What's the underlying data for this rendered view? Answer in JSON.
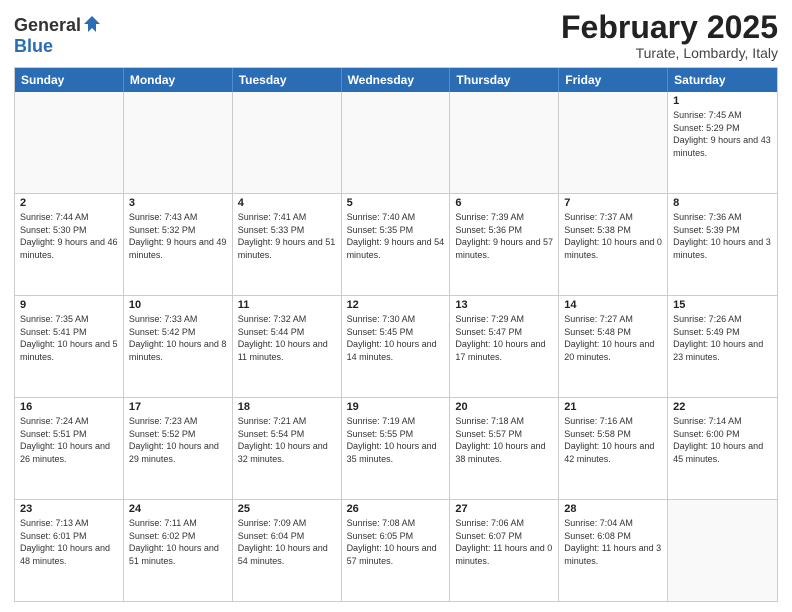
{
  "logo": {
    "general": "General",
    "blue": "Blue"
  },
  "title": "February 2025",
  "location": "Turate, Lombardy, Italy",
  "header": {
    "days": [
      "Sunday",
      "Monday",
      "Tuesday",
      "Wednesday",
      "Thursday",
      "Friday",
      "Saturday"
    ]
  },
  "weeks": [
    {
      "cells": [
        {
          "day": "",
          "empty": true
        },
        {
          "day": "",
          "empty": true
        },
        {
          "day": "",
          "empty": true
        },
        {
          "day": "",
          "empty": true
        },
        {
          "day": "",
          "empty": true
        },
        {
          "day": "",
          "empty": true
        },
        {
          "day": "1",
          "info": "Sunrise: 7:45 AM\nSunset: 5:29 PM\nDaylight: 9 hours and 43 minutes."
        }
      ]
    },
    {
      "cells": [
        {
          "day": "2",
          "info": "Sunrise: 7:44 AM\nSunset: 5:30 PM\nDaylight: 9 hours and 46 minutes."
        },
        {
          "day": "3",
          "info": "Sunrise: 7:43 AM\nSunset: 5:32 PM\nDaylight: 9 hours and 49 minutes."
        },
        {
          "day": "4",
          "info": "Sunrise: 7:41 AM\nSunset: 5:33 PM\nDaylight: 9 hours and 51 minutes."
        },
        {
          "day": "5",
          "info": "Sunrise: 7:40 AM\nSunset: 5:35 PM\nDaylight: 9 hours and 54 minutes."
        },
        {
          "day": "6",
          "info": "Sunrise: 7:39 AM\nSunset: 5:36 PM\nDaylight: 9 hours and 57 minutes."
        },
        {
          "day": "7",
          "info": "Sunrise: 7:37 AM\nSunset: 5:38 PM\nDaylight: 10 hours and 0 minutes."
        },
        {
          "day": "8",
          "info": "Sunrise: 7:36 AM\nSunset: 5:39 PM\nDaylight: 10 hours and 3 minutes."
        }
      ]
    },
    {
      "cells": [
        {
          "day": "9",
          "info": "Sunrise: 7:35 AM\nSunset: 5:41 PM\nDaylight: 10 hours and 5 minutes."
        },
        {
          "day": "10",
          "info": "Sunrise: 7:33 AM\nSunset: 5:42 PM\nDaylight: 10 hours and 8 minutes."
        },
        {
          "day": "11",
          "info": "Sunrise: 7:32 AM\nSunset: 5:44 PM\nDaylight: 10 hours and 11 minutes."
        },
        {
          "day": "12",
          "info": "Sunrise: 7:30 AM\nSunset: 5:45 PM\nDaylight: 10 hours and 14 minutes."
        },
        {
          "day": "13",
          "info": "Sunrise: 7:29 AM\nSunset: 5:47 PM\nDaylight: 10 hours and 17 minutes."
        },
        {
          "day": "14",
          "info": "Sunrise: 7:27 AM\nSunset: 5:48 PM\nDaylight: 10 hours and 20 minutes."
        },
        {
          "day": "15",
          "info": "Sunrise: 7:26 AM\nSunset: 5:49 PM\nDaylight: 10 hours and 23 minutes."
        }
      ]
    },
    {
      "cells": [
        {
          "day": "16",
          "info": "Sunrise: 7:24 AM\nSunset: 5:51 PM\nDaylight: 10 hours and 26 minutes."
        },
        {
          "day": "17",
          "info": "Sunrise: 7:23 AM\nSunset: 5:52 PM\nDaylight: 10 hours and 29 minutes."
        },
        {
          "day": "18",
          "info": "Sunrise: 7:21 AM\nSunset: 5:54 PM\nDaylight: 10 hours and 32 minutes."
        },
        {
          "day": "19",
          "info": "Sunrise: 7:19 AM\nSunset: 5:55 PM\nDaylight: 10 hours and 35 minutes."
        },
        {
          "day": "20",
          "info": "Sunrise: 7:18 AM\nSunset: 5:57 PM\nDaylight: 10 hours and 38 minutes."
        },
        {
          "day": "21",
          "info": "Sunrise: 7:16 AM\nSunset: 5:58 PM\nDaylight: 10 hours and 42 minutes."
        },
        {
          "day": "22",
          "info": "Sunrise: 7:14 AM\nSunset: 6:00 PM\nDaylight: 10 hours and 45 minutes."
        }
      ]
    },
    {
      "cells": [
        {
          "day": "23",
          "info": "Sunrise: 7:13 AM\nSunset: 6:01 PM\nDaylight: 10 hours and 48 minutes."
        },
        {
          "day": "24",
          "info": "Sunrise: 7:11 AM\nSunset: 6:02 PM\nDaylight: 10 hours and 51 minutes."
        },
        {
          "day": "25",
          "info": "Sunrise: 7:09 AM\nSunset: 6:04 PM\nDaylight: 10 hours and 54 minutes."
        },
        {
          "day": "26",
          "info": "Sunrise: 7:08 AM\nSunset: 6:05 PM\nDaylight: 10 hours and 57 minutes."
        },
        {
          "day": "27",
          "info": "Sunrise: 7:06 AM\nSunset: 6:07 PM\nDaylight: 11 hours and 0 minutes."
        },
        {
          "day": "28",
          "info": "Sunrise: 7:04 AM\nSunset: 6:08 PM\nDaylight: 11 hours and 3 minutes."
        },
        {
          "day": "",
          "empty": true
        }
      ]
    }
  ]
}
